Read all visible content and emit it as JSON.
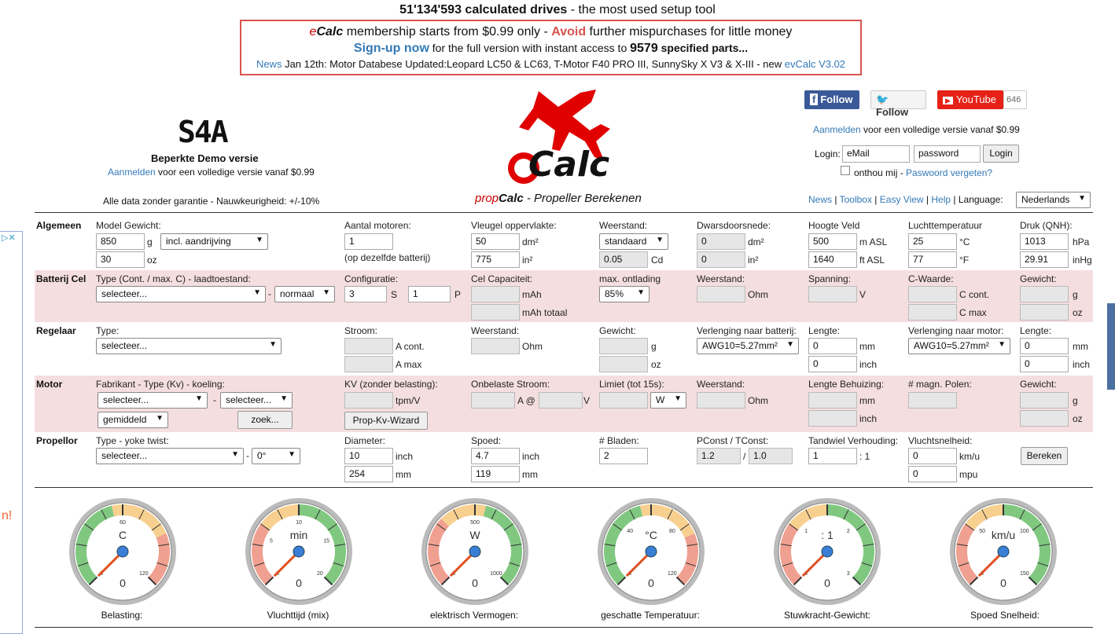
{
  "banner": {
    "count": "51'134'593 calculated drives",
    "count_suffix": " - the most used setup tool",
    "l1_a": "membership starts from $0.99 only - ",
    "l1_avoid": "Avoid",
    "l1_b": " further mispurchases for little money",
    "signup": "Sign-up now",
    "l2_a": " for the full version with instant access to ",
    "l2_num": "9579",
    "l2_b": " specified parts...",
    "news_link": "News",
    "news_text": " Jan 12th: Motor Databese Updated:Leopard LC50 & LC63, T-Motor F40 PRO III, SunnySky X V3 & X-III - new ",
    "evcalc": "evCalc V3.02"
  },
  "brand": {
    "e": "e",
    "calc": "Calc",
    "prop": "prop",
    "calc2": "Calc",
    "subtitle": " - Propeller Berekenen"
  },
  "left": {
    "logo": "S4A",
    "demo": "Beperkte Demo versie",
    "aanmelden": "Aanmelden",
    "full": " voor een volledige versie vanaf $0.99",
    "disclaimer": "Alle data zonder garantie - Nauwkeurigheid: +/-10%"
  },
  "social": {
    "facebook": "Follow",
    "twitter": "Follow",
    "youtube": "YouTube",
    "yt_count": "646"
  },
  "login": {
    "aanmelden": "Aanmelden",
    "full": " voor een volledige versie vanaf $0.99",
    "label": "Login:",
    "email": "eMail",
    "password": "password",
    "button": "Login",
    "remember": "onthou mij - ",
    "forgot": "Paswoord vergeten?"
  },
  "nav": {
    "news": "News",
    "toolbox": "Toolbox",
    "easyview": "Easy View",
    "help": "Help",
    "language_label": "Language:",
    "language": "Nederlands"
  },
  "general": {
    "section": "Algemeen",
    "model_weight_label": "Model Gewicht:",
    "weight_g": "850",
    "unit_g": "g",
    "weight_opt": "incl. aandrijving",
    "weight_oz": "30",
    "unit_oz": "oz",
    "motors_label": "Aantal motoren:",
    "motors": "1",
    "motors_note": "(op dezelfde batterij)",
    "wing_label": "Vleugel oppervlakte:",
    "wing_dm": "50",
    "unit_dm": "dm²",
    "wing_in": "775",
    "unit_in": "in²",
    "drag_label": "Weerstand:",
    "drag": "standaard",
    "cd": "0.05",
    "unit_cd": "Cd",
    "cross_label": "Dwarsdoorsnede:",
    "cross_dm": "0",
    "cross_in": "0",
    "elev_label": "Hoogte Veld",
    "elev_m": "500",
    "unit_m": "m ASL",
    "elev_ft": "1640",
    "unit_ft": "ft ASL",
    "temp_label": "Luchttemperatuur",
    "temp_c": "25",
    "unit_c": "°C",
    "temp_f": "77",
    "unit_f": "°F",
    "press_label": "Druk (QNH):",
    "press_hpa": "1013",
    "unit_hpa": "hPa",
    "press_inhg": "29.91",
    "unit_inhg": "inHg"
  },
  "battery": {
    "section": "Batterij Cel",
    "type_label": "Type (Cont. / max. C) - laadtoestand:",
    "type": "selecteer...",
    "charge": "normaal",
    "config_label": "Configuratie:",
    "s": "3",
    "unit_s": "S",
    "p": "1",
    "unit_p": "P",
    "cap_label": "Cel Capaciteit:",
    "unit_mah": "mAh",
    "unit_mah_total": "mAh totaal",
    "dis_label": "max. ontlading",
    "dis": "85%",
    "res_label": "Weerstand:",
    "unit_ohm": "Ohm",
    "volt_label": "Spanning:",
    "unit_v": "V",
    "c_label": "C-Waarde:",
    "unit_ccont": "C cont.",
    "unit_cmax": "C max",
    "w_label": "Gewicht:",
    "unit_g": "g",
    "unit_oz": "oz"
  },
  "esc": {
    "section": "Regelaar",
    "type_label": "Type:",
    "type": "selecteer...",
    "cur_label": "Stroom:",
    "unit_acont": "A cont.",
    "unit_amax": "A max",
    "res_label": "Weerstand:",
    "unit_ohm": "Ohm",
    "w_label": "Gewicht:",
    "unit_g": "g",
    "unit_oz": "oz",
    "extb_label": "Verlenging naar batterij:",
    "extb": "AWG10=5.27mm²",
    "lenb_label": "Lengte:",
    "lenb_mm": "0",
    "lenb_in": "0",
    "unit_mm": "mm",
    "unit_inch": "inch",
    "extm_label": "Verlenging naar motor:",
    "extm": "AWG10=5.27mm²",
    "lenm_label": "Lengte:",
    "lenm_mm": "0",
    "lenm_in": "0"
  },
  "motor": {
    "section": "Motor",
    "type_label": "Fabrikant - Type (Kv) - koeling:",
    "manu": "selecteer...",
    "type": "selecteer...",
    "cooling": "gemiddeld",
    "search": "zoek...",
    "kv_label": "KV (zonder belasting):",
    "unit_kv": "tpm/V",
    "wizard": "Prop-Kv-Wizard",
    "noload_label": "Onbelaste Stroom:",
    "unit_a_at": "A @",
    "unit_v": "V",
    "limit_label": "Limiet (tot 15s):",
    "limit_unit": "W",
    "res_label": "Weerstand:",
    "unit_ohm": "Ohm",
    "case_label": "Lengte Behuizing:",
    "unit_mm": "mm",
    "unit_inch": "inch",
    "poles_label": "# magn. Polen:",
    "w_label": "Gewicht:",
    "unit_g": "g",
    "unit_oz": "oz"
  },
  "prop": {
    "section": "Propellor",
    "type_label": "Type - yoke twist:",
    "type": "selecteer...",
    "twist": "0°",
    "dia_label": "Diameter:",
    "dia_in": "10",
    "dia_mm": "254",
    "unit_inch": "inch",
    "unit_mm": "mm",
    "pitch_label": "Spoed:",
    "pitch_in": "4.7",
    "pitch_mm": "119",
    "blades_label": "# Bladen:",
    "blades": "2",
    "pconst_label": "PConst / TConst:",
    "pconst": "1.2",
    "tconst": "1.0",
    "gear_label": "Tandwiel Verhouding:",
    "gear": "1",
    "gear_suffix": ": 1",
    "speed_label": "Vluchtsnelheid:",
    "speed_kmh": "0",
    "unit_kmh": "km/u",
    "speed_mph": "0",
    "unit_mph": "mpu",
    "calc": "Bereken"
  },
  "gauges": [
    {
      "unit": "C",
      "value": "0",
      "ticks": [
        "0",
        "60",
        "120"
      ],
      "caption": "Belasting:"
    },
    {
      "unit": "min",
      "value": "0",
      "ticks": [
        "0",
        "5",
        "10",
        "15",
        "20"
      ],
      "caption": "Vluchttijd (mix)"
    },
    {
      "unit": "W",
      "value": "0",
      "ticks": [
        "0",
        "500",
        "1000"
      ],
      "caption": "elektrisch Vermogen:"
    },
    {
      "unit": "°C",
      "value": "0",
      "ticks": [
        "0",
        "40",
        "80",
        "120"
      ],
      "caption": "geschatte Temperatuur:"
    },
    {
      "unit": ": 1",
      "value": "0",
      "ticks": [
        "0",
        "1",
        "2",
        "3"
      ],
      "caption": "Stuwkracht-Gewicht:"
    },
    {
      "unit": "km/u",
      "value": "0",
      "ticks": [
        "0",
        "50",
        "100",
        "150"
      ],
      "caption": "Spoed Snelheid:"
    }
  ],
  "colors": {
    "pink": "#f5dedf",
    "accent": "#337ab7",
    "red": "#d9534f"
  }
}
